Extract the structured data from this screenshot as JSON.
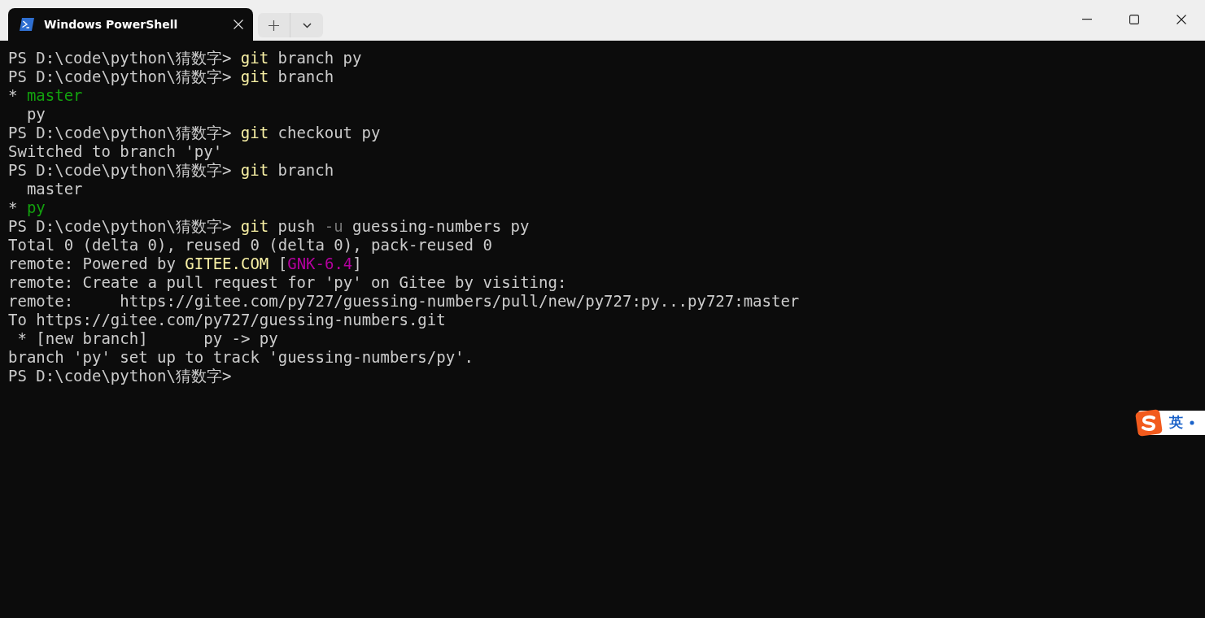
{
  "window": {
    "tabs": [
      {
        "title": "Windows PowerShell",
        "selected": true
      }
    ],
    "controls": [
      {
        "kind": "minimize"
      },
      {
        "kind": "maximize"
      },
      {
        "kind": "close"
      }
    ]
  },
  "terminal": {
    "lines": [
      [
        {
          "text": "PS D:\\code\\python\\猜数字> ",
          "color": "#cccccc"
        },
        {
          "text": "git",
          "color": "#f9f1a5"
        },
        {
          "text": " branch py",
          "color": "#cccccc"
        }
      ],
      [
        {
          "text": "PS D:\\code\\python\\猜数字> ",
          "color": "#cccccc"
        },
        {
          "text": "git",
          "color": "#f9f1a5"
        },
        {
          "text": " branch",
          "color": "#cccccc"
        }
      ],
      [
        {
          "text": "* ",
          "color": "#cccccc"
        },
        {
          "text": "master",
          "color": "#13a10e"
        }
      ],
      [
        {
          "text": "  py",
          "color": "#cccccc"
        }
      ],
      [
        {
          "text": "PS D:\\code\\python\\猜数字> ",
          "color": "#cccccc"
        },
        {
          "text": "git",
          "color": "#f9f1a5"
        },
        {
          "text": " checkout py",
          "color": "#cccccc"
        }
      ],
      [
        {
          "text": "Switched to branch 'py'",
          "color": "#cccccc"
        }
      ],
      [
        {
          "text": "PS D:\\code\\python\\猜数字> ",
          "color": "#cccccc"
        },
        {
          "text": "git",
          "color": "#f9f1a5"
        },
        {
          "text": " branch",
          "color": "#cccccc"
        }
      ],
      [
        {
          "text": "  master",
          "color": "#cccccc"
        }
      ],
      [
        {
          "text": "* ",
          "color": "#cccccc"
        },
        {
          "text": "py",
          "color": "#13a10e"
        }
      ],
      [
        {
          "text": "PS D:\\code\\python\\猜数字> ",
          "color": "#cccccc"
        },
        {
          "text": "git",
          "color": "#f9f1a5"
        },
        {
          "text": " push ",
          "color": "#cccccc"
        },
        {
          "text": "-u",
          "color": "#767676"
        },
        {
          "text": " guessing-numbers py",
          "color": "#cccccc"
        }
      ],
      [
        {
          "text": "Total 0 (delta 0), reused 0 (delta 0), pack-reused 0",
          "color": "#cccccc"
        }
      ],
      [
        {
          "text": "remote: Powered by ",
          "color": "#cccccc"
        },
        {
          "text": "GITEE.COM",
          "color": "#f9f1a5"
        },
        {
          "text": " [",
          "color": "#cccccc"
        },
        {
          "text": "GNK-6.4",
          "color": "#b4009e"
        },
        {
          "text": "]",
          "color": "#cccccc"
        }
      ],
      [
        {
          "text": "remote: Create a pull request for 'py' on Gitee by visiting:",
          "color": "#cccccc"
        }
      ],
      [
        {
          "text": "remote:     https://gitee.com/py727/guessing-numbers/pull/new/py727:py...py727:master",
          "color": "#cccccc"
        }
      ],
      [
        {
          "text": "To https://gitee.com/py727/guessing-numbers.git",
          "color": "#cccccc"
        }
      ],
      [
        {
          "text": " * [new branch]      py -> py",
          "color": "#cccccc"
        }
      ],
      [
        {
          "text": "branch 'py' set up to track 'guessing-numbers/py'.",
          "color": "#cccccc"
        }
      ],
      [
        {
          "text": "PS D:\\code\\python\\猜数字>",
          "color": "#cccccc"
        }
      ]
    ]
  },
  "ime": {
    "label": "英"
  }
}
